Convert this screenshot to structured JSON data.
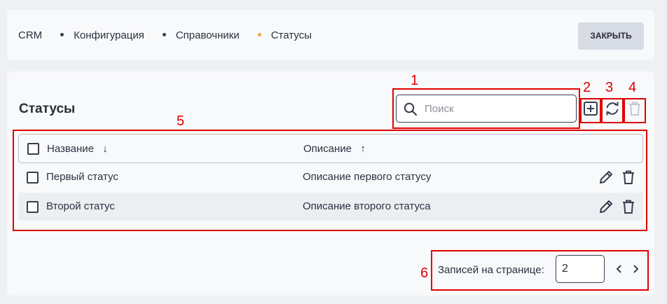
{
  "breadcrumb": [
    "CRM",
    "Конфигурация",
    "Справочники",
    "Статусы"
  ],
  "close_label": "ЗАКРЫТЬ",
  "title": "Статусы",
  "search": {
    "placeholder": "Поиск",
    "value": ""
  },
  "columns": [
    {
      "label": "Название",
      "sort": "↓"
    },
    {
      "label": "Описание",
      "sort": "↑"
    }
  ],
  "rows": [
    {
      "name": "Первый статус",
      "description": "Описание первого статусу"
    },
    {
      "name": "Второй статус",
      "description": "Описание второго статуса"
    }
  ],
  "pagination": {
    "label": "Записей на странице:",
    "per_page": "2"
  },
  "annotations": [
    "1",
    "2",
    "3",
    "4",
    "5",
    "6"
  ],
  "colors": {
    "accent_dot": "#e8a83a",
    "annotation": "#e00000",
    "disabled_icon": "#c4c8d0"
  },
  "icons": [
    "search-icon",
    "add-icon",
    "refresh-icon",
    "delete-icon",
    "edit-icon",
    "chevron-left-icon",
    "chevron-right-icon"
  ]
}
